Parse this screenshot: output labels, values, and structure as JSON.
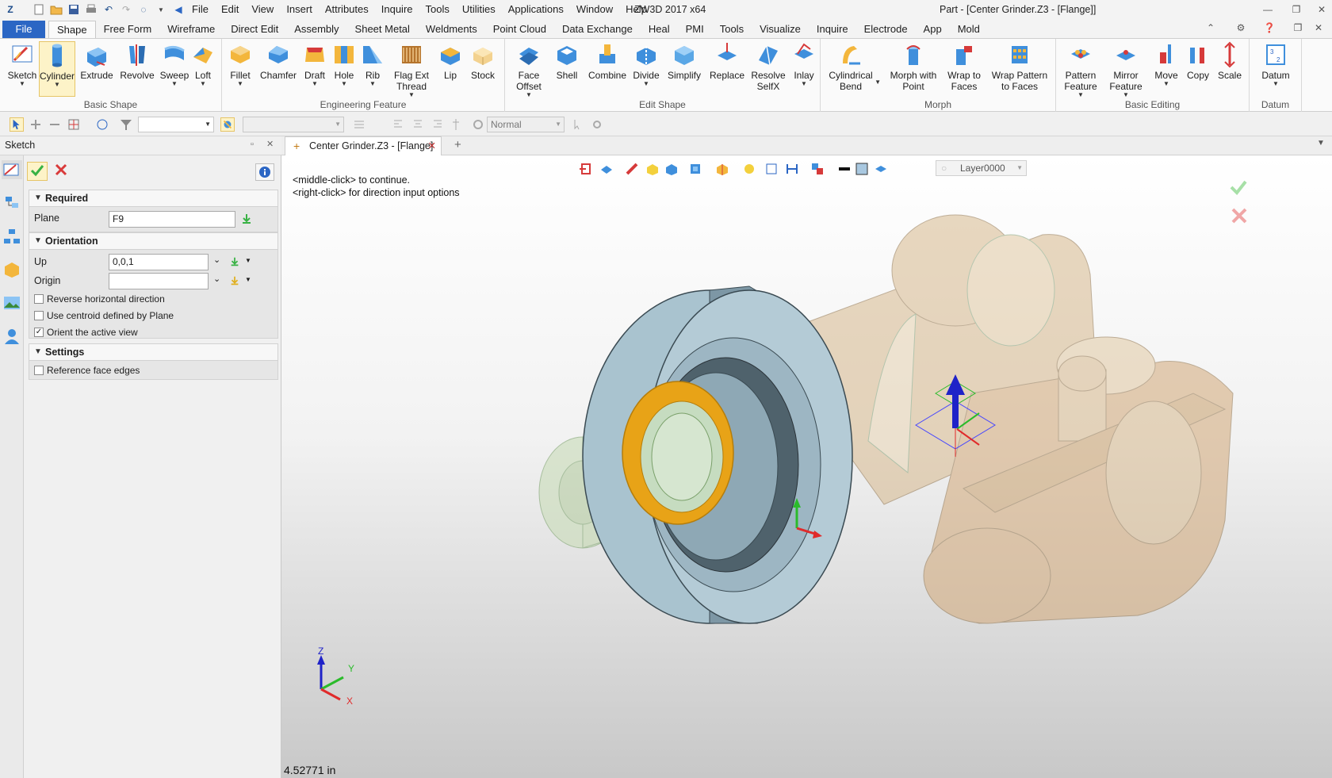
{
  "titlebar": {
    "menus": [
      "File",
      "Edit",
      "View",
      "Insert",
      "Attributes",
      "Inquire",
      "Tools",
      "Utilities",
      "Applications",
      "Window",
      "Help"
    ],
    "app_title": "ZW3D 2017  x64",
    "doc_title": "Part - [Center Grinder.Z3 - [Flange]]"
  },
  "ribbon_tabs": {
    "file": "File",
    "tabs": [
      "Shape",
      "Free Form",
      "Wireframe",
      "Direct Edit",
      "Assembly",
      "Sheet Metal",
      "Weldments",
      "Point Cloud",
      "Data Exchange",
      "Heal",
      "PMI",
      "Tools",
      "Visualize",
      "Inquire",
      "Electrode",
      "App",
      "Mold"
    ],
    "active": "Shape"
  },
  "ribbon": {
    "groups": [
      {
        "label": "Basic Shape",
        "buttons": [
          "Sketch",
          "Cylinder",
          "Extrude",
          "Revolve",
          "Sweep",
          "Loft"
        ]
      },
      {
        "label": "Engineering Feature",
        "buttons": [
          "Fillet",
          "Chamfer",
          "Draft",
          "Hole",
          "Rib",
          "Flag Ext Thread",
          "Lip",
          "Stock"
        ]
      },
      {
        "label": "Edit Shape",
        "buttons": [
          "Face Offset",
          "Shell",
          "Combine",
          "Divide",
          "Simplify",
          "Replace",
          "Resolve SelfX",
          "Inlay"
        ]
      },
      {
        "label": "Morph",
        "buttons": [
          "Cylindrical Bend",
          "Morph with Point",
          "Wrap to Faces",
          "Wrap Pattern to Faces"
        ]
      },
      {
        "label": "Basic Editing",
        "buttons": [
          "Pattern Feature",
          "Mirror Feature",
          "Move",
          "Copy",
          "Scale"
        ]
      },
      {
        "label": "Datum",
        "buttons": [
          "Datum"
        ]
      }
    ]
  },
  "toolbar2": {
    "render_mode": "Normal"
  },
  "panel": {
    "title": "Sketch",
    "required": {
      "header": "Required",
      "plane_label": "Plane",
      "plane_value": "F9"
    },
    "orientation": {
      "header": "Orientation",
      "up_label": "Up",
      "up_value": "0,0,1",
      "origin_label": "Origin",
      "origin_value": "",
      "options": [
        {
          "label": "Reverse horizontal direction",
          "checked": false
        },
        {
          "label": "Use centroid defined by Plane",
          "checked": false
        },
        {
          "label": "Orient the active view",
          "checked": true
        }
      ]
    },
    "settings": {
      "header": "Settings",
      "options": [
        {
          "label": "Reference face edges",
          "checked": false
        }
      ]
    }
  },
  "viewport": {
    "doc_tab": "Center Grinder.Z3 - [Flange]",
    "prompt_line1": "<middle-click> to continue.",
    "prompt_line2": "<right-click> for direction input options",
    "layer": "Layer0000",
    "readout": "4.52771 in",
    "axis_labels": {
      "x": "X",
      "y": "Y",
      "z": "Z"
    }
  },
  "colors": {
    "file_tab": "#2b66c4",
    "flange": "#a9c3cf",
    "highlight_ring": "#e8a317",
    "transparent_body": "#d8b98b",
    "confirm": "#38b244",
    "cancel": "#d93a3a"
  }
}
